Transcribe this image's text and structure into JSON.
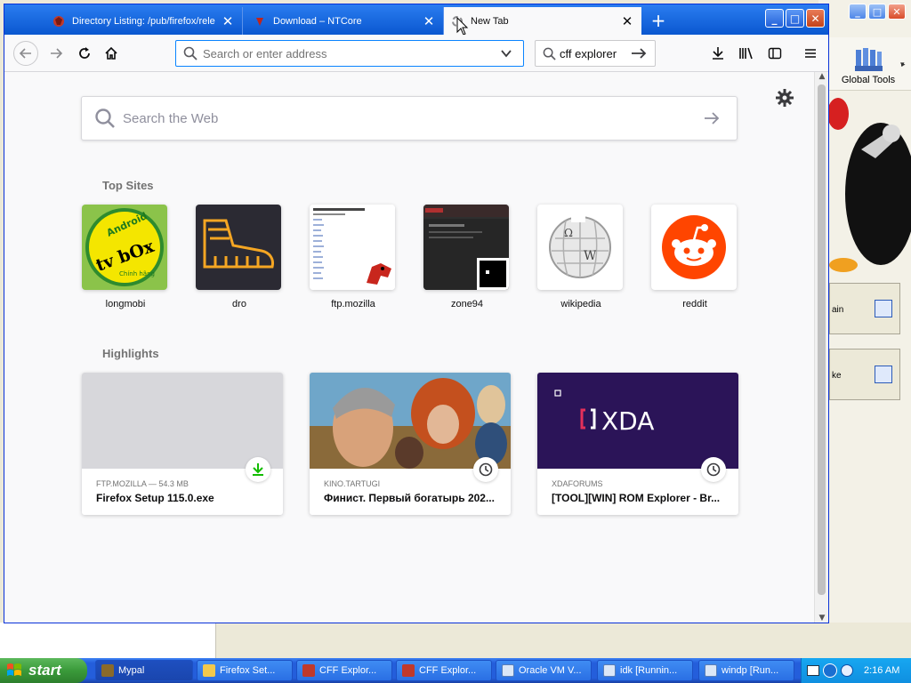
{
  "background_app": {
    "tool_label": "Global Tools",
    "cards": [
      {
        "label": "ain"
      },
      {
        "label": "ke"
      }
    ]
  },
  "browser": {
    "tabs": [
      {
        "title": "Directory Listing: /pub/firefox/rele",
        "icon": "firefox-ftp-favicon-icon",
        "active": false
      },
      {
        "title": "Download – NTCore",
        "icon": "ntcore-favicon-icon",
        "active": false
      },
      {
        "title": "New Tab",
        "icon": "loading-favicon-icon",
        "active": true
      }
    ],
    "new_tab_glyph": "+",
    "urlbar": {
      "placeholder": "Search or enter address",
      "value": ""
    },
    "searchbar": {
      "value": "cff explorer"
    }
  },
  "newtab": {
    "web_search_placeholder": "Search the Web",
    "top_sites_heading": "Top Sites",
    "top_sites": [
      {
        "label": "longmobi"
      },
      {
        "label": "dro"
      },
      {
        "label": "ftp.mozilla"
      },
      {
        "label": "zone94"
      },
      {
        "label": "wikipedia"
      },
      {
        "label": "reddit"
      }
    ],
    "longmobi_logo": {
      "line1": "Android",
      "line2": "tv bOx",
      "line3": "Chính hãng"
    },
    "highlights_heading": "Highlights",
    "highlights": [
      {
        "context": "FTP.MOZILLA — 54.3 MB",
        "title": "Firefox Setup 115.0.exe",
        "badge": "download-icon"
      },
      {
        "context": "KINO.TARTUGI",
        "title": "Финист. Первый богатырь 202...",
        "badge": "history-clock-icon"
      },
      {
        "context": "XDAFORUMS",
        "title": "[TOOL][WIN] ROM Explorer - Br...",
        "badge": "history-clock-icon"
      }
    ],
    "xda_logo_text": "XDA"
  },
  "taskbar": {
    "start_label": "start",
    "tasks": [
      {
        "label": "Mypal"
      },
      {
        "label": "Firefox Set..."
      },
      {
        "label": "CFF Explor..."
      },
      {
        "label": "CFF Explor..."
      },
      {
        "label": "Oracle VM V..."
      },
      {
        "label": "idk [Runnin..."
      },
      {
        "label": "windp [Run..."
      }
    ],
    "clock": "2:16 AM"
  },
  "colors": {
    "xp_blue": "#245EDB",
    "start_green": "#3A9A3A",
    "firefox_accent": "#0A84FF",
    "reddit_orange": "#FF4500",
    "download_green": "#12BC00",
    "xda_purple": "#2B1458"
  }
}
